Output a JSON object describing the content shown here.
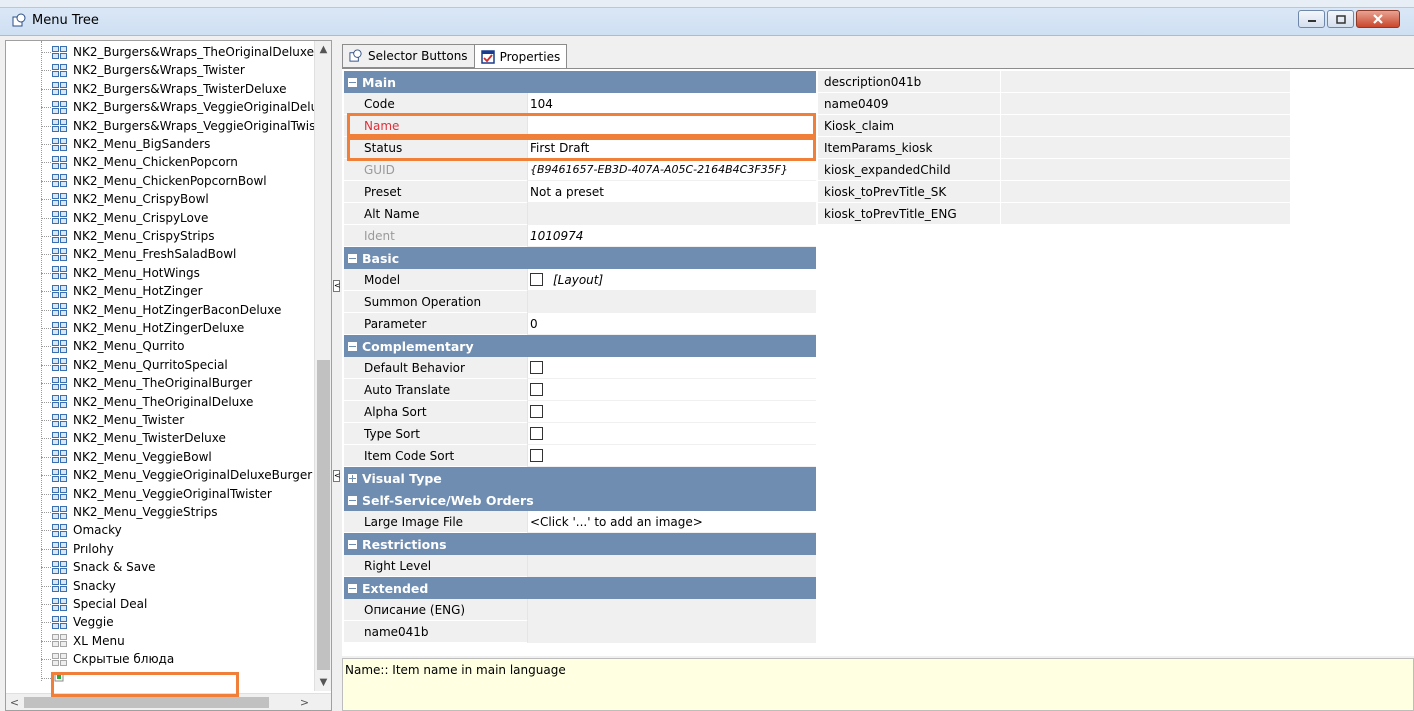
{
  "window": {
    "title": "Menu Tree",
    "icon": "app-icon"
  },
  "tree": {
    "items": [
      {
        "label": "NK2_Burgers&Wraps_TheOriginalDeluxe",
        "enabled": true
      },
      {
        "label": "NK2_Burgers&Wraps_Twister",
        "enabled": true
      },
      {
        "label": "NK2_Burgers&Wraps_TwisterDeluxe",
        "enabled": true
      },
      {
        "label": "NK2_Burgers&Wraps_VeggieOriginalDelu:",
        "enabled": true
      },
      {
        "label": "NK2_Burgers&Wraps_VeggieOriginalTwist",
        "enabled": true
      },
      {
        "label": "NK2_Menu_BigSanders",
        "enabled": true
      },
      {
        "label": "NK2_Menu_ChickenPopcorn",
        "enabled": true
      },
      {
        "label": "NK2_Menu_ChickenPopcornBowl",
        "enabled": true
      },
      {
        "label": "NK2_Menu_CrispyBowl",
        "enabled": true
      },
      {
        "label": "NK2_Menu_CrispyLove",
        "enabled": true
      },
      {
        "label": "NK2_Menu_CrispyStrips",
        "enabled": true
      },
      {
        "label": "NK2_Menu_FreshSaladBowl",
        "enabled": true
      },
      {
        "label": "NK2_Menu_HotWings",
        "enabled": true
      },
      {
        "label": "NK2_Menu_HotZinger",
        "enabled": true
      },
      {
        "label": "NK2_Menu_HotZingerBaconDeluxe",
        "enabled": true
      },
      {
        "label": "NK2_Menu_HotZingerDeluxe",
        "enabled": true
      },
      {
        "label": "NK2_Menu_Qurrito",
        "enabled": true
      },
      {
        "label": "NK2_Menu_QurritoSpecial",
        "enabled": true
      },
      {
        "label": "NK2_Menu_TheOriginalBurger",
        "enabled": true
      },
      {
        "label": "NK2_Menu_TheOriginalDeluxe",
        "enabled": true
      },
      {
        "label": "NK2_Menu_Twister",
        "enabled": true
      },
      {
        "label": "NK2_Menu_TwisterDeluxe",
        "enabled": true
      },
      {
        "label": "NK2_Menu_VeggieBowl",
        "enabled": true
      },
      {
        "label": "NK2_Menu_VeggieOriginalDeluxeBurger",
        "enabled": true
      },
      {
        "label": "NK2_Menu_VeggieOriginalTwister",
        "enabled": true
      },
      {
        "label": "NK2_Menu_VeggieStrips",
        "enabled": true
      },
      {
        "label": "Omacky",
        "enabled": true
      },
      {
        "label": "Prılohy",
        "enabled": true
      },
      {
        "label": "Snack & Save",
        "enabled": true
      },
      {
        "label": "Snacky",
        "enabled": true
      },
      {
        "label": "Special Deal",
        "enabled": true
      },
      {
        "label": "Veggie",
        "enabled": true
      },
      {
        "label": "XL Menu",
        "enabled": false
      },
      {
        "label": "Скрытые блюда",
        "enabled": false
      },
      {
        "label": "",
        "enabled": true,
        "new": true
      }
    ]
  },
  "tabs": [
    {
      "label": "Selector Buttons",
      "active": false,
      "icon": "selector-icon"
    },
    {
      "label": "Properties",
      "active": true,
      "icon": "properties-icon"
    }
  ],
  "properties": {
    "main_label": "Main",
    "code": {
      "name": "Code",
      "value": "104"
    },
    "name": {
      "name": "Name",
      "value": ""
    },
    "status": {
      "name": "Status",
      "value": "First Draft"
    },
    "guid": {
      "name": "GUID",
      "value": "{B9461657-EB3D-407A-A05C-2164B4C3F35F}"
    },
    "preset": {
      "name": "Preset",
      "value": "Not a preset"
    },
    "alt_name": {
      "name": "Alt Name",
      "value": ""
    },
    "ident": {
      "name": "Ident",
      "value": "1010974"
    },
    "basic_label": "Basic",
    "model": {
      "name": "Model",
      "value": "[Layout]",
      "checked": false
    },
    "summon": {
      "name": "Summon Operation",
      "value": ""
    },
    "parameter": {
      "name": "Parameter",
      "value": "0"
    },
    "complementary_label": "Complementary",
    "default_behavior": {
      "name": "Default Behavior",
      "checked": false
    },
    "auto_translate": {
      "name": "Auto Translate",
      "checked": false
    },
    "alpha_sort": {
      "name": "Alpha Sort",
      "checked": false
    },
    "type_sort": {
      "name": "Type Sort",
      "checked": false
    },
    "item_code_sort": {
      "name": "Item Code Sort",
      "checked": false
    },
    "visual_type_label": "Visual Type",
    "self_service_label": "Self-Service/Web Orders",
    "large_image": {
      "name": "Large Image File",
      "value": "<Click '...' to add an image>"
    },
    "restrictions_label": "Restrictions",
    "right_level": {
      "name": "Right Level",
      "value": ""
    },
    "extended_label": "Extended",
    "opisanie": {
      "name": "Описание (ENG)",
      "value": ""
    },
    "name041b": {
      "name": "name041b",
      "value": ""
    }
  },
  "right_list": [
    {
      "name": "description041b",
      "value": ""
    },
    {
      "name": "name0409",
      "value": ""
    },
    {
      "name": "Kiosk_claim",
      "value": ""
    },
    {
      "name": "ItemParams_kiosk",
      "value": ""
    },
    {
      "name": "kiosk_expandedChild",
      "value": ""
    },
    {
      "name": "kiosk_toPrevTitle_SK",
      "value": ""
    },
    {
      "name": "kiosk_toPrevTitle_ENG",
      "value": ""
    }
  ],
  "description": "Name:: Item name in main language",
  "colors": {
    "category": "#6f8db0",
    "highlight": "#f07f3a",
    "description_bg": "#ffffe1",
    "required_red": "#e0303a"
  }
}
